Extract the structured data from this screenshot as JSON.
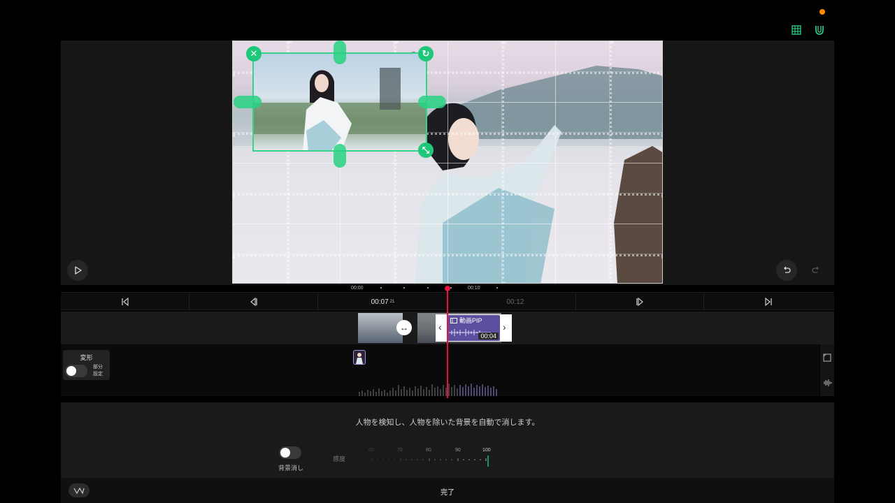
{
  "top_bar": {
    "grid_icon": "grid-icon",
    "magnet_icon": "magnet-icon",
    "notification_color": "#ff8a00"
  },
  "preview": {
    "play_icon": "play-icon",
    "undo_icon": "undo-icon",
    "redo_icon": "redo-icon",
    "handle_close": "✕",
    "handle_rotate": "↻",
    "handle_scale": "⤡",
    "accent": "#1fc77a"
  },
  "ruler": {
    "labels": [
      "00:00",
      "00:10"
    ]
  },
  "transport": {
    "current_time": "00:07",
    "current_frame": "21",
    "end_time": "00:12",
    "buttons": [
      "skip-to-start-icon",
      "prev-frame-icon",
      "next-frame-icon",
      "skip-to-end-icon"
    ]
  },
  "timeline": {
    "pip_clip_label": "動画PIP",
    "pip_clip_duration": "00:04",
    "playhead_color": "#e8123c",
    "swap_icon": "↔"
  },
  "transform_panel": {
    "title": "変形",
    "partial_line1": "部分",
    "partial_line2": "設定",
    "toggle_on": false
  },
  "background_removal": {
    "description": "人物を検知し、人物を除いた背景を自動で消します。",
    "toggle_label": "背景消し",
    "toggle_on": false,
    "sensitivity_label": "感度",
    "scale_labels": [
      "60",
      "70",
      "80",
      "90",
      "100"
    ],
    "sensitivity_value": 100
  },
  "footer": {
    "done_label": "完了"
  }
}
